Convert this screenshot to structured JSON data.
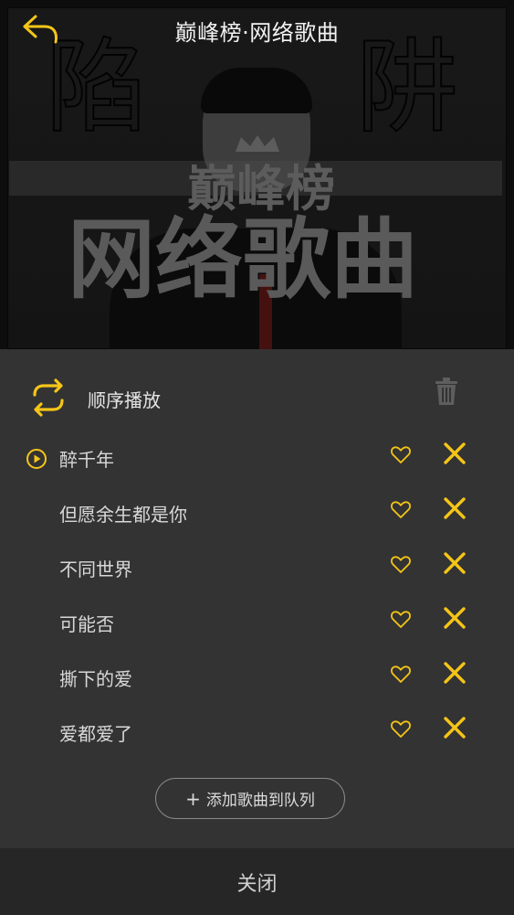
{
  "header": {
    "title": "巅峰榜·网络歌曲",
    "back_icon": "back-arrow-icon"
  },
  "cover": {
    "logo_text": "巅峰榜",
    "big_title": "网络歌曲",
    "left_char": "陷",
    "right_char": "阱"
  },
  "playlist": {
    "mode_label": "顺序播放",
    "mode_icon": "repeat-icon",
    "trash_icon": "trash-icon",
    "songs": [
      {
        "title": "醉千年",
        "playing": true
      },
      {
        "title": "但愿余生都是你",
        "playing": false
      },
      {
        "title": "不同世界",
        "playing": false
      },
      {
        "title": "可能否",
        "playing": false
      },
      {
        "title": "撕下的爱",
        "playing": false
      },
      {
        "title": "爱都爱了",
        "playing": false
      }
    ],
    "add_button_label": "添加歌曲到队列",
    "add_button_icon": "+"
  },
  "footer": {
    "close_label": "关闭"
  },
  "colors": {
    "accent": "#f5c518",
    "panel_bg": "#333333",
    "footer_bg": "#262626",
    "text": "#d8d8d8"
  }
}
